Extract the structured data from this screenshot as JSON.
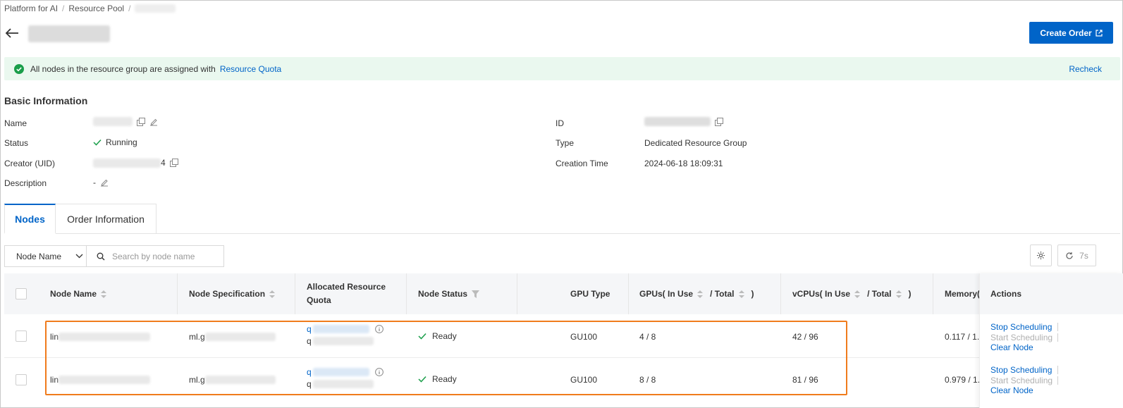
{
  "breadcrumb": {
    "item1": "Platform for AI",
    "item2": "Resource Pool",
    "sep": "/"
  },
  "header": {
    "create_order_label": "Create Order"
  },
  "banner": {
    "message": "All nodes in the resource group are assigned with",
    "link": "Resource Quota",
    "recheck": "Recheck"
  },
  "basic_info": {
    "title": "Basic Information",
    "labels": {
      "name": "Name",
      "status": "Status",
      "creator": "Creator (UID)",
      "description": "Description",
      "id": "ID",
      "type": "Type",
      "creation_time": "Creation Time"
    },
    "values": {
      "status": "Running",
      "creator_suffix": "4",
      "description": "-",
      "type": "Dedicated Resource Group",
      "creation_time": "2024-06-18 18:09:31"
    }
  },
  "tabs": [
    {
      "label": "Nodes"
    },
    {
      "label": "Order Information"
    }
  ],
  "toolbar": {
    "filter_select": "Node Name",
    "search_placeholder": "Search by node name",
    "refresh_label": "7s"
  },
  "table": {
    "headers": {
      "node_name": "Node Name",
      "node_spec": "Node Specification",
      "allocated_quota": "Allocated Resource Quota",
      "node_status": "Node Status",
      "gpu_type": "GPU Type",
      "gpus_prefix": "GPUs(",
      "in_use": "In Use",
      "slash_total": "/ Total",
      "close_paren": ")",
      "vcpus_prefix": "vCPUs(",
      "memory": "Memory(",
      "actions": "Actions"
    },
    "rows": [
      {
        "node_prefix": "lin",
        "spec_prefix": "ml.g",
        "quota_prefix_1": "q",
        "quota_prefix_2": "q",
        "status": "Ready",
        "gpu_type": "GU100",
        "gpus": "4 / 8",
        "vcpus": "42 / 96",
        "memory": "0.117 / 1."
      },
      {
        "node_prefix": "lin",
        "spec_prefix": "ml.g",
        "quota_prefix_1": "q",
        "quota_prefix_2": "q",
        "status": "Ready",
        "gpu_type": "GU100",
        "gpus": "8 / 8",
        "vcpus": "81 / 96",
        "memory": "0.979 / 1."
      }
    ],
    "actions": {
      "stop": "Stop Scheduling",
      "start": "Start Scheduling",
      "clear": "Clear Node"
    }
  },
  "colors": {
    "primary": "#0064c8",
    "success": "#1a9e4a",
    "highlight": "#f07c1d",
    "banner_bg": "#eaf8ef"
  }
}
